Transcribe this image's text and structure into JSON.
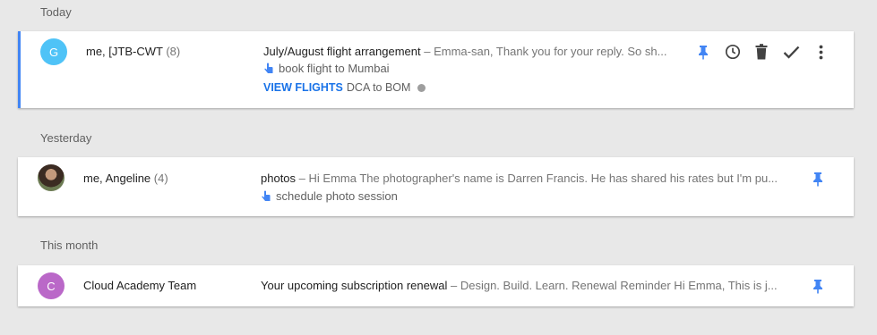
{
  "sections": {
    "today": "Today",
    "yesterday": "Yesterday",
    "this_month": "This month"
  },
  "threads": [
    {
      "avatar_letter": "G",
      "avatar_color": "#4fc3f7",
      "sender": "me, [JTB-CWT",
      "count": "(8)",
      "subject": "July/August flight arrangement",
      "dash": " – ",
      "snippet": "Emma-san, Thank you for your reply. So sh...",
      "reminder": "book flight to Mumbai",
      "action_label": "VIEW FLIGHTS",
      "action_detail": "DCA to BOM"
    },
    {
      "avatar_letter": "",
      "sender": "me, Angeline",
      "count": "(4)",
      "subject": "photos",
      "dash": " – ",
      "snippet": "Hi Emma The photographer's name is Darren Francis. He has shared his rates but I'm pu...",
      "reminder": "schedule photo session"
    },
    {
      "avatar_letter": "C",
      "avatar_color": "#ba68c8",
      "sender": "Cloud Academy Team",
      "count": "",
      "subject": "Your upcoming subscription renewal",
      "dash": " – ",
      "snippet": "Design. Build. Learn. Renewal Reminder Hi Emma, This is j..."
    }
  ],
  "icons": {
    "pin": "pin-icon",
    "snooze": "clock-icon",
    "delete": "trash-icon",
    "done": "check-icon",
    "more": "more-vert-icon",
    "reminder": "reminder-hand-icon",
    "info": "info-icon"
  },
  "colors": {
    "accent": "#4285f4",
    "link": "#1a73e8",
    "background": "#e8e8e8"
  }
}
